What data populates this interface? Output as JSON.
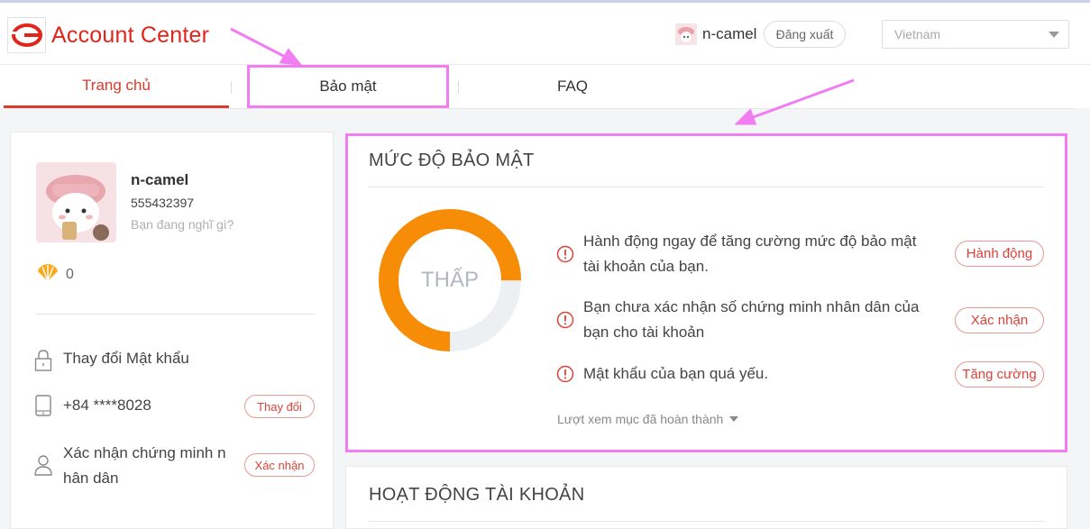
{
  "header": {
    "brand": "Account Center",
    "user_name": "n-camel",
    "logout_label": "Đăng xuất",
    "country": "Vietnam"
  },
  "nav": {
    "tabs": [
      {
        "label": "Trang chủ",
        "active": true
      },
      {
        "label": "Bảo mật",
        "active": false
      },
      {
        "label": "FAQ",
        "active": false
      }
    ]
  },
  "profile": {
    "name": "n-camel",
    "id": "555432397",
    "status_placeholder": "Bạn đang nghĩ gì?",
    "shells": "0",
    "rows": [
      {
        "icon": "lock-icon",
        "text": "Thay đổi Mật khẩu",
        "button": ""
      },
      {
        "icon": "phone-icon",
        "text": "+84 ****8028",
        "button": "Thay đổi"
      },
      {
        "icon": "person-icon",
        "text_line1": "Xác nhận chứng minh n",
        "text_line2": "hân dân",
        "button": "Xác nhận"
      }
    ]
  },
  "security": {
    "title": "MỨC ĐỘ BẢO MẬT",
    "level": "THẤP",
    "level_fraction": 0.75,
    "items": [
      {
        "line1": "Hành động ngay để tăng cường mức độ bảo mật",
        "line2": "tài khoản của bạn.",
        "button": "Hành động"
      },
      {
        "line1": "Bạn chưa xác nhận số chứng minh nhân dân của",
        "line2": "bạn cho tài khoản",
        "button": "Xác nhận"
      },
      {
        "line1": "Mật khẩu của bạn quá yếu.",
        "line2": "",
        "button": "Tăng cường"
      }
    ],
    "view_completed": "Lượt xem mục đã hoàn thành"
  },
  "activity": {
    "title": "HOẠT ĐỘNG TÀI KHOẢN"
  },
  "colors": {
    "brand_red": "#e1251b",
    "accent_orange": "#f78c06",
    "highlight_pink": "#f27cf1"
  }
}
